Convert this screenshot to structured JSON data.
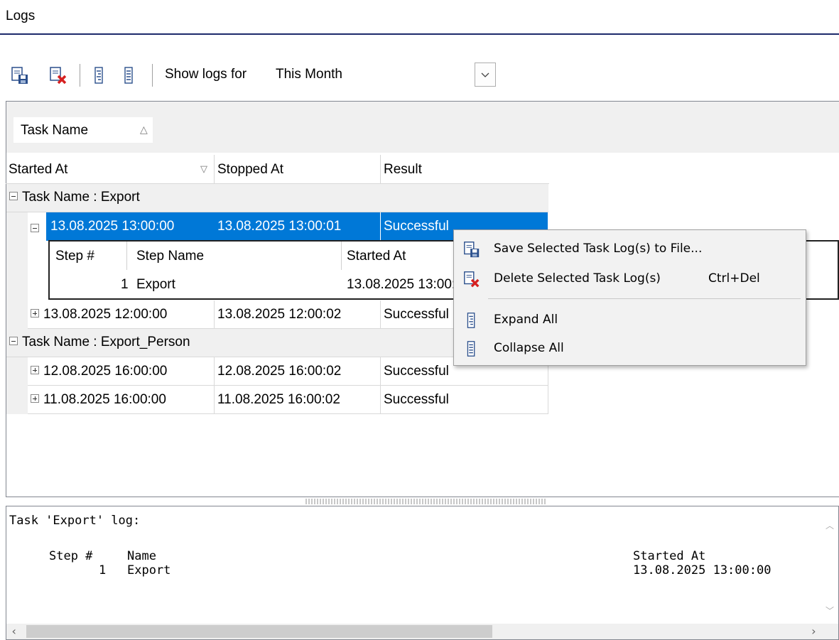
{
  "section_title": "Logs",
  "toolbar": {
    "show_logs_label": "Show logs for",
    "period_value": "This Month",
    "icons": [
      "save-log-icon",
      "delete-log-icon",
      "expand-all-icon",
      "collapse-all-icon",
      "chevron-down-icon"
    ]
  },
  "grid": {
    "group_by_label": "Task Name",
    "group_sort": "ascending",
    "columns": [
      "Started At",
      "Stopped At",
      "Result"
    ],
    "groups": [
      {
        "label": "Task Name : Export",
        "rows": [
          {
            "started": "13.08.2025 13:00:00",
            "stopped": "13.08.2025 13:00:01",
            "result": "Successful",
            "expanded": true,
            "selected": true
          },
          {
            "started": "13.08.2025 12:00:00",
            "stopped": "13.08.2025 12:00:02",
            "result": "Successful",
            "expanded": false,
            "selected": false
          }
        ]
      },
      {
        "label": "Task Name : Export_Person",
        "rows": [
          {
            "started": "12.08.2025 16:00:00",
            "stopped": "12.08.2025 16:00:02",
            "result": "Successful",
            "expanded": false,
            "selected": false
          },
          {
            "started": "11.08.2025 16:00:00",
            "stopped": "11.08.2025 16:00:02",
            "result": "Successful",
            "expanded": false,
            "selected": false
          }
        ]
      }
    ],
    "detail": {
      "columns": [
        "Step #",
        "Step Name",
        "Started At"
      ],
      "rows": [
        {
          "step": "1",
          "name": "Export",
          "started": "13.08.2025 13:00:00"
        }
      ]
    }
  },
  "context_menu": {
    "items": [
      {
        "label": "Save Selected Task Log(s) to File...",
        "shortcut": "",
        "icon": "save-log-icon"
      },
      {
        "label": "Delete Selected Task Log(s)",
        "shortcut": "Ctrl+Del",
        "icon": "delete-log-icon"
      },
      {
        "label": "Expand All",
        "shortcut": "",
        "icon": "expand-all-icon"
      },
      {
        "label": "Collapse All",
        "shortcut": "",
        "icon": "collapse-all-icon"
      }
    ]
  },
  "log_text": {
    "heading": "Task 'Export' log:",
    "col_step": "Step #",
    "col_name": "Name",
    "col_started": "Started At",
    "row_step": "1",
    "row_name": "Export",
    "row_started": "13.08.2025 13:00:00"
  },
  "colors": {
    "selection": "#0078d7",
    "title_rule": "#1d2a6b",
    "panel_bg": "#f0f0f0"
  }
}
